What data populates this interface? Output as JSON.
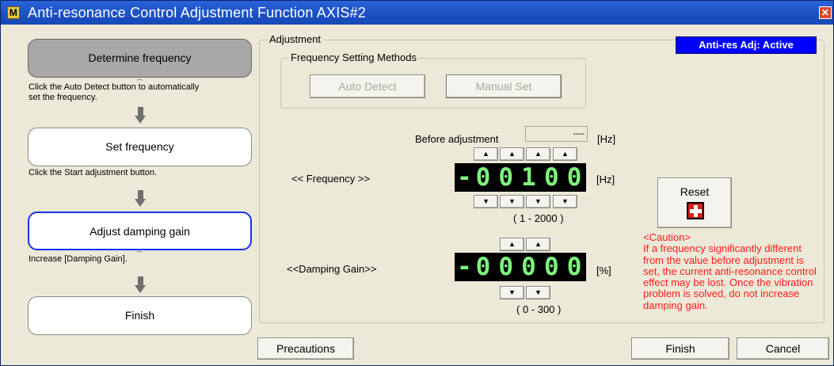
{
  "window": {
    "title": "Anti-resonance Control Adjustment Function AXIS#2",
    "app_icon": "M",
    "close_glyph": "✕"
  },
  "flow": {
    "steps": [
      {
        "label": "Determine frequency",
        "state": "active"
      },
      {
        "label": "Set frequency",
        "state": "normal"
      },
      {
        "label": "Adjust damping gain",
        "state": "current"
      },
      {
        "label": "Finish",
        "state": "normal"
      }
    ],
    "hints": [
      "Click the Auto Detect button to automatically set the frequency.",
      "Click the Start adjustment button.",
      "Increase [Damping Gain]."
    ]
  },
  "adjustment": {
    "group_label": "Adjustment",
    "status_badge": "Anti-res Adj: Active",
    "methods": {
      "group_label": "Frequency Setting Methods",
      "auto_detect": "Auto Detect",
      "manual_set": "Manual Set"
    },
    "before_label": "Before adjustment",
    "before_value": "----",
    "before_unit": "[Hz]",
    "frequency": {
      "label": "<< Frequency >>",
      "display": "-00100",
      "unit": "[Hz]",
      "range": "( 1 - 2000 )",
      "up_glyph": "▲",
      "down_glyph": "▼"
    },
    "damping": {
      "label": "<<Damping Gain>>",
      "display": "-00000",
      "unit": "[%]",
      "range": "( 0 - 300 )"
    },
    "reset": {
      "label": "Reset",
      "icon": "plus-icon"
    },
    "caution": {
      "title": "<Caution>",
      "text": "If a frequency significantly different from the value before adjustment is set, the current anti-resonance control effect may be lost. Once the vibration problem is solved, do not increase damping gain."
    }
  },
  "footer": {
    "precautions": "Precautions",
    "finish": "Finish",
    "cancel": "Cancel"
  },
  "colors": {
    "titlebar": "#1b4fc2",
    "badge": "#0000ff",
    "lcd_digit": "#7df37d",
    "caution_text": "#ff1a1a",
    "current_step_border": "#1a2ff2"
  }
}
